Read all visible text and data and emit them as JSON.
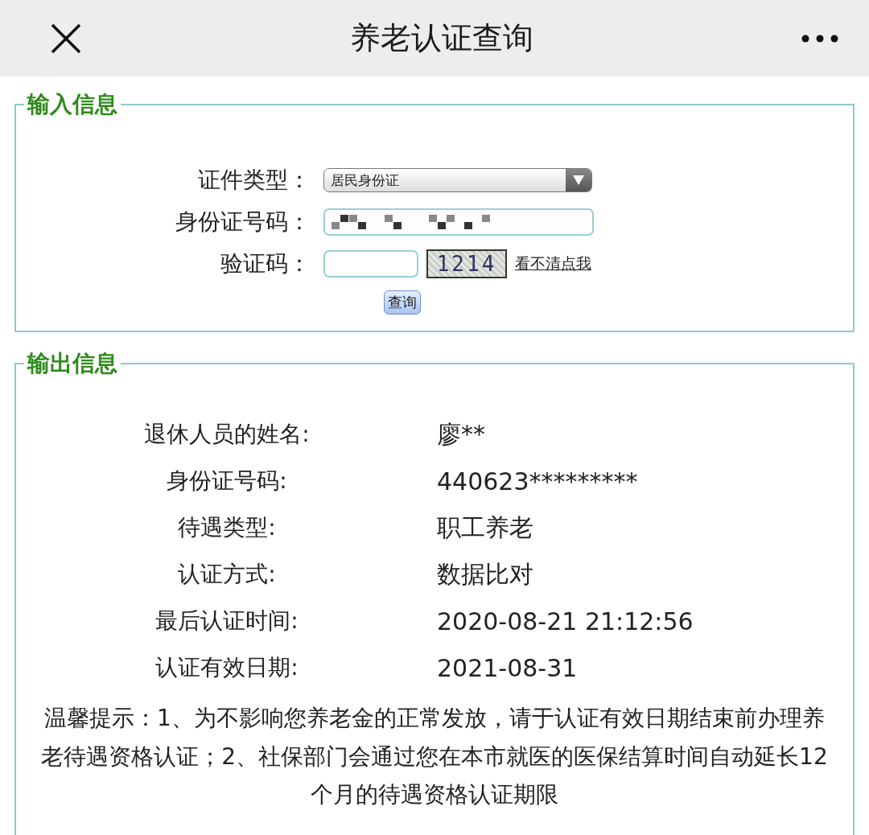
{
  "header": {
    "title": "养老认证查询"
  },
  "input_section": {
    "legend": "输入信息",
    "fields": [
      {
        "kind": "select",
        "label": "证件类型：",
        "value": "居民身份证"
      },
      {
        "kind": "redacted",
        "label": "身份证号码："
      },
      {
        "kind": "captcha",
        "label": "验证码：",
        "captcha": "1214",
        "refresh_link": "看不清点我"
      }
    ],
    "submit": "查询"
  },
  "output_section": {
    "legend": "输出信息",
    "rows": [
      {
        "label": "退休人员的姓名:",
        "value": "廖**"
      },
      {
        "label": "身份证号码:",
        "value": "440623*********"
      },
      {
        "label": "待遇类型:",
        "value": "职工养老"
      },
      {
        "label": "认证方式:",
        "value": "数据比对"
      },
      {
        "label": "最后认证时间:",
        "value": "2020-08-21 21:12:56"
      },
      {
        "label": "认证有效日期:",
        "value": "2021-08-31"
      }
    ],
    "tip": "温馨提示：1、为不影响您养老金的正常发放，请于认证有效日期结束前办理养老待遇资格认证；2、社保部门会通过您在本市就医的医保结算时间自动延长12个月的待遇资格认证期限"
  }
}
